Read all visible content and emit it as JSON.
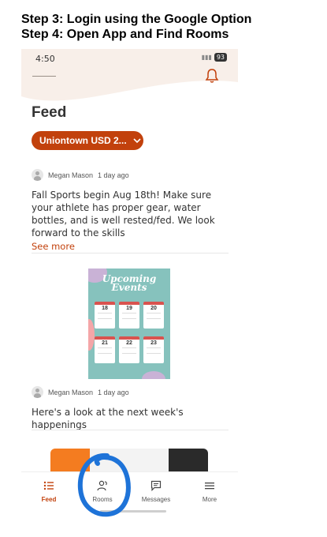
{
  "instructions": {
    "line1": "Step 3: Login using the Google Option",
    "line2": "Step 4: Open App and Find Rooms"
  },
  "status_bar": {
    "time": "4:50",
    "battery": "93"
  },
  "header": {
    "title": "Feed",
    "school_selector": "Uniontown USD 2..."
  },
  "posts": [
    {
      "author": "Megan  Mason",
      "time": "1 day ago",
      "text": "Fall Sports begin Aug 18th! Make sure your athlete has proper gear, water bottles, and is well rested/fed. We look forward to the skills",
      "see_more": "See more"
    },
    {
      "author": "Megan  Mason",
      "time": "1 day ago",
      "text": "Here's a look at the next week's happenings"
    }
  ],
  "flyer": {
    "title_line1": "Upcoming",
    "title_line2": "Events",
    "dates": [
      "18",
      "19",
      "20",
      "21",
      "22",
      "23"
    ]
  },
  "tabs": [
    {
      "label": "Feed",
      "icon": "list-icon",
      "active": true
    },
    {
      "label": "Rooms",
      "icon": "people-icon",
      "active": false
    },
    {
      "label": "Messages",
      "icon": "chat-icon",
      "active": false
    },
    {
      "label": "More",
      "icon": "menu-icon",
      "active": false
    }
  ],
  "colors": {
    "accent": "#c2410c",
    "annotation": "#1e73d8",
    "header_bg": "#f8efe9"
  }
}
